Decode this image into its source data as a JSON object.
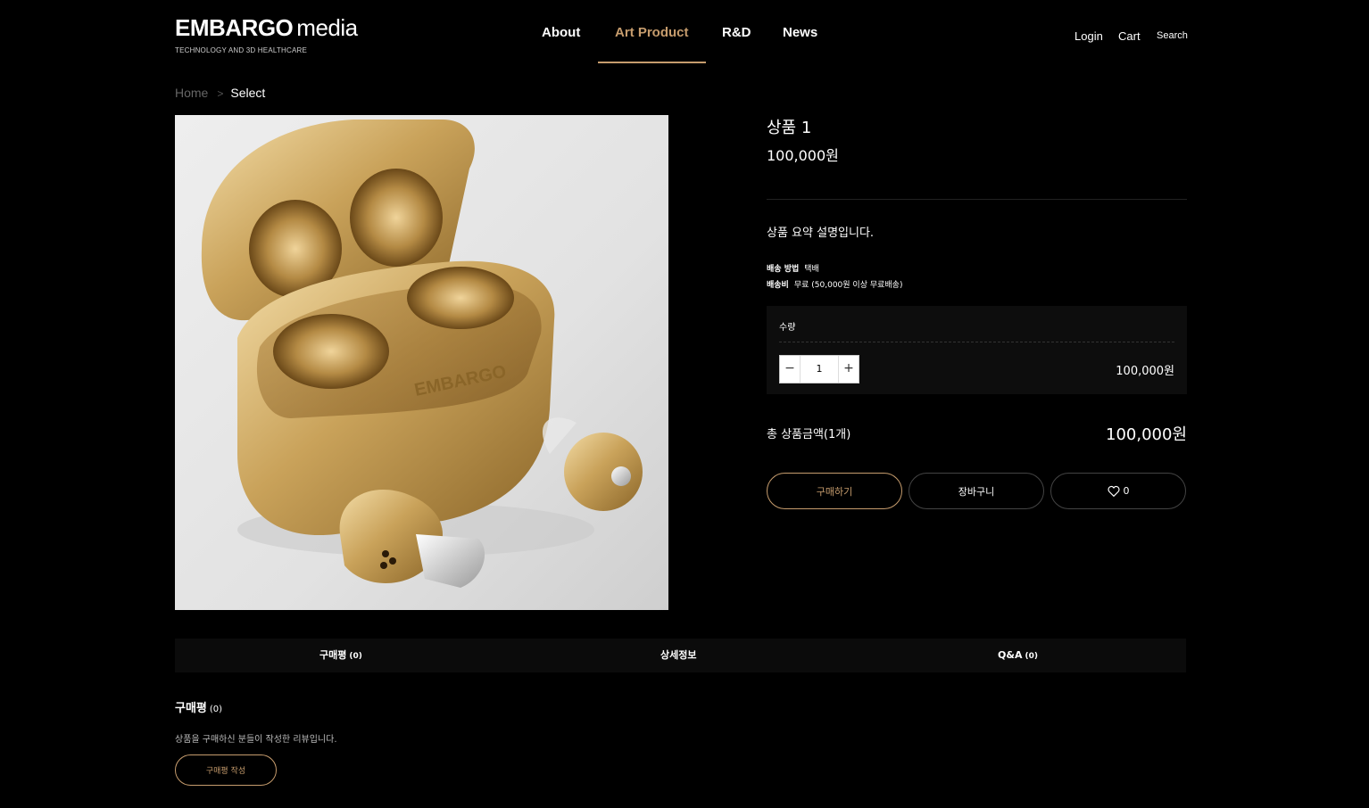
{
  "brand": {
    "logo_bold": "EMBARGO",
    "logo_light": "media",
    "tagline": "TECHNOLOGY AND 3D HEALTHCARE"
  },
  "nav": {
    "items": [
      {
        "label": "About"
      },
      {
        "label": "Art Product",
        "active": true
      },
      {
        "label": "R&D"
      },
      {
        "label": "News"
      }
    ]
  },
  "util": {
    "login": "Login",
    "cart": "Cart",
    "search": "Search"
  },
  "breadcrumb": {
    "home": "Home",
    "separator": ">",
    "current": "Select"
  },
  "product": {
    "name": "상품 1",
    "price": "100,000원",
    "summary": "상품 요약 설명입니다.",
    "shipping_method_label": "배송 방법",
    "shipping_method_value": "택배",
    "shipping_fee_label": "배송비",
    "shipping_fee_value": "무료 (50,000원 이상 무료배송)",
    "image_icon": "gold-earbuds-case-photo"
  },
  "quantity": {
    "label": "수량",
    "value": "1",
    "minus": "−",
    "plus": "+",
    "subtotal": "100,000원"
  },
  "total": {
    "label": "총 상품금액(1개)",
    "value": "100,000원"
  },
  "actions": {
    "buy": "구매하기",
    "cart": "장바구니",
    "wish_count": "0",
    "wish_icon": "heart-icon"
  },
  "tabs": [
    {
      "label": "구매평",
      "count": "(0)"
    },
    {
      "label": "상세정보",
      "count": ""
    },
    {
      "label": "Q&A",
      "count": "(0)"
    }
  ],
  "review": {
    "title": "구매평",
    "count": "(0)",
    "description": "상품을 구매하신 분들이 작성한 리뷰입니다.",
    "write_button": "구매평 작성"
  },
  "colors": {
    "accent": "#c69c6d",
    "background": "#000000",
    "panel": "#0d0d0d"
  }
}
